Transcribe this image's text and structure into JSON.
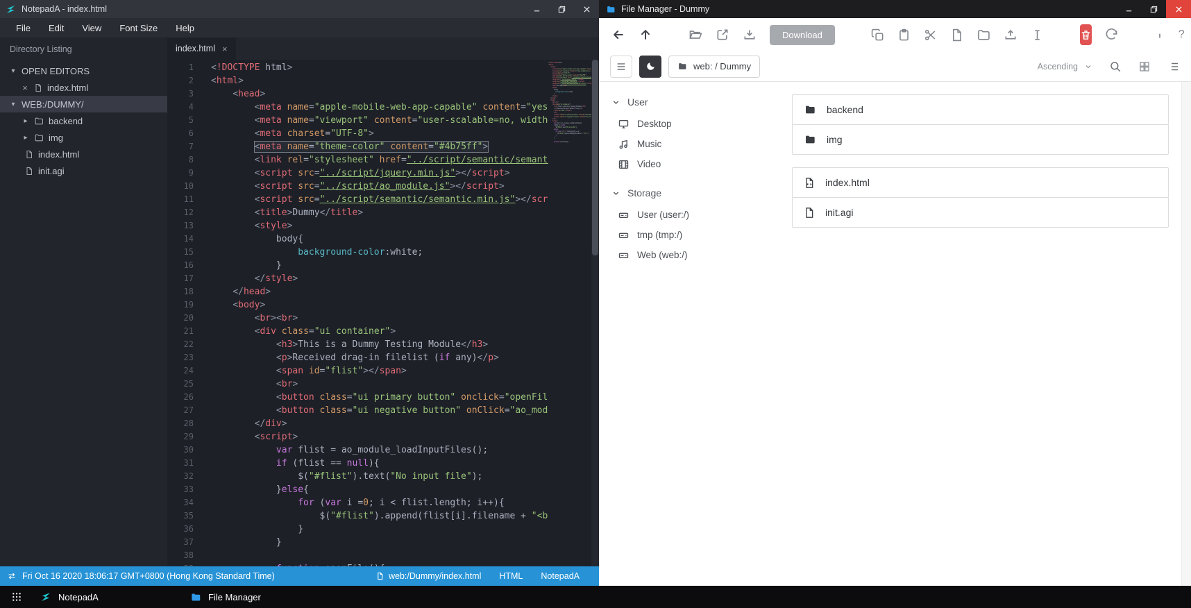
{
  "notepad": {
    "title": "NotepadA - index.html",
    "menu": [
      "File",
      "Edit",
      "View",
      "Font Size",
      "Help"
    ],
    "sidebar_title": "Directory Listing",
    "tree": {
      "open_editors_label": "OPEN EDITORS",
      "open_editors": [
        {
          "name": "index.html"
        }
      ],
      "folder_label": "WEB:/DUMMY/",
      "items": [
        {
          "name": "backend",
          "type": "folder"
        },
        {
          "name": "img",
          "type": "folder"
        },
        {
          "name": "index.html",
          "type": "file"
        },
        {
          "name": "init.agi",
          "type": "file"
        }
      ]
    },
    "tab": "index.html",
    "active_line": 7,
    "code_lines": [
      "<!DOCTYPE html>",
      "<html>",
      "    <head>",
      "        <meta name=\"apple-mobile-web-app-capable\" content=\"yes\">",
      "        <meta name=\"viewport\" content=\"user-scalable=no, width=device-width\">",
      "        <meta charset=\"UTF-8\">",
      "        <meta name=\"theme-color\" content=\"#4b75ff\">",
      "        <link rel=\"stylesheet\" href=\"../script/semantic/semantic.min.css\">",
      "        <script src=\"../script/jquery.min.js\"></script>",
      "        <script src=\"../script/ao_module.js\"></script>",
      "        <script src=\"../script/semantic/semantic.min.js\"></script>",
      "        <title>Dummy</title>",
      "        <style>",
      "            body{",
      "                background-color:white;",
      "            }",
      "        </style>",
      "    </head>",
      "    <body>",
      "        <br><br>",
      "        <div class=\"ui container\">",
      "            <h3>This is a Dummy Testing Module</h3>",
      "            <p>Received drag-in filelist (if any)</p>",
      "            <span id=\"flist\"></span>",
      "            <br>",
      "            <button class=\"ui primary button\" onclick=\"openFile()\">Open File</button>",
      "            <button class=\"ui negative button\" onClick=\"ao_module_close()\">Close</button>",
      "        </div>",
      "        <script>",
      "            var flist = ao_module_loadInputFiles();",
      "            if (flist == null){",
      "                $(\"#flist\").text(\"No input file\");",
      "            }else{",
      "                for (var i =0; i < flist.length; i++){",
      "                    $(\"#flist\").append(flist[i].filename + \"<br>\");",
      "                }",
      "            }",
      "",
      "            function openFile(){"
    ],
    "statusbar": {
      "time": "Fri Oct 16 2020 18:06:17 GMT+0800 (Hong Kong Standard Time)",
      "path": "web:/Dummy/index.html",
      "lang": "HTML",
      "app": "NotepadA"
    }
  },
  "filemanager": {
    "title": "File Manager - Dummy",
    "toolbar": {
      "download_label": "Download"
    },
    "breadcrumb": "web: / Dummy",
    "sort_label": "Ascending",
    "sidebar": {
      "sections": [
        {
          "label": "User",
          "items": [
            {
              "name": "Desktop",
              "icon": "desktop-icon"
            },
            {
              "name": "Music",
              "icon": "music-icon"
            },
            {
              "name": "Video",
              "icon": "video-icon"
            }
          ]
        },
        {
          "label": "Storage",
          "items": [
            {
              "name": "User (user:/)",
              "icon": "drive-icon"
            },
            {
              "name": "tmp (tmp:/)",
              "icon": "drive-icon"
            },
            {
              "name": "Web (web:/)",
              "icon": "drive-icon"
            }
          ]
        }
      ]
    },
    "files": {
      "folders": [
        {
          "name": "backend"
        },
        {
          "name": "img"
        }
      ],
      "files": [
        {
          "name": "index.html"
        },
        {
          "name": "init.agi"
        }
      ]
    }
  },
  "taskbar": {
    "items": [
      {
        "label": "NotepadA"
      },
      {
        "label": "File Manager"
      }
    ]
  },
  "icons": {
    "notepada-logo": "teal-zigzag",
    "window-minimize": "minus",
    "window-maximize": "overlapping-squares",
    "window-close": "x",
    "back": "arrow-left",
    "up": "arrow-up",
    "open-folder": "folder-open",
    "open-external": "external-link",
    "download": "tray-down-arrow",
    "copy": "two-pages",
    "paste": "clipboard",
    "cut": "scissors",
    "new-file": "file",
    "new-folder": "folder",
    "upload": "tray-up-arrow",
    "rename": "text-cursor",
    "delete": "trash",
    "refresh": "circular-arrow",
    "info": "i",
    "help": "?",
    "menu": "hamburger",
    "darkmode": "moon",
    "search": "magnifier",
    "grid-view": "grid",
    "list-view": "list",
    "time": "swap-arrows",
    "file-manager-logo": "blue-folder",
    "apps": "dot-grid"
  },
  "colors": {
    "statusbar_blue": "#2793d6",
    "delete_red": "#e15252",
    "logo_teal": "#1fc8cf",
    "fm_title_icon_blue": "#2f9be8",
    "syntax": {
      "tag": "#e06c75",
      "attr": "#d19a66",
      "string": "#98c379",
      "keyword": "#c678dd",
      "text": "#abb2bf"
    }
  }
}
